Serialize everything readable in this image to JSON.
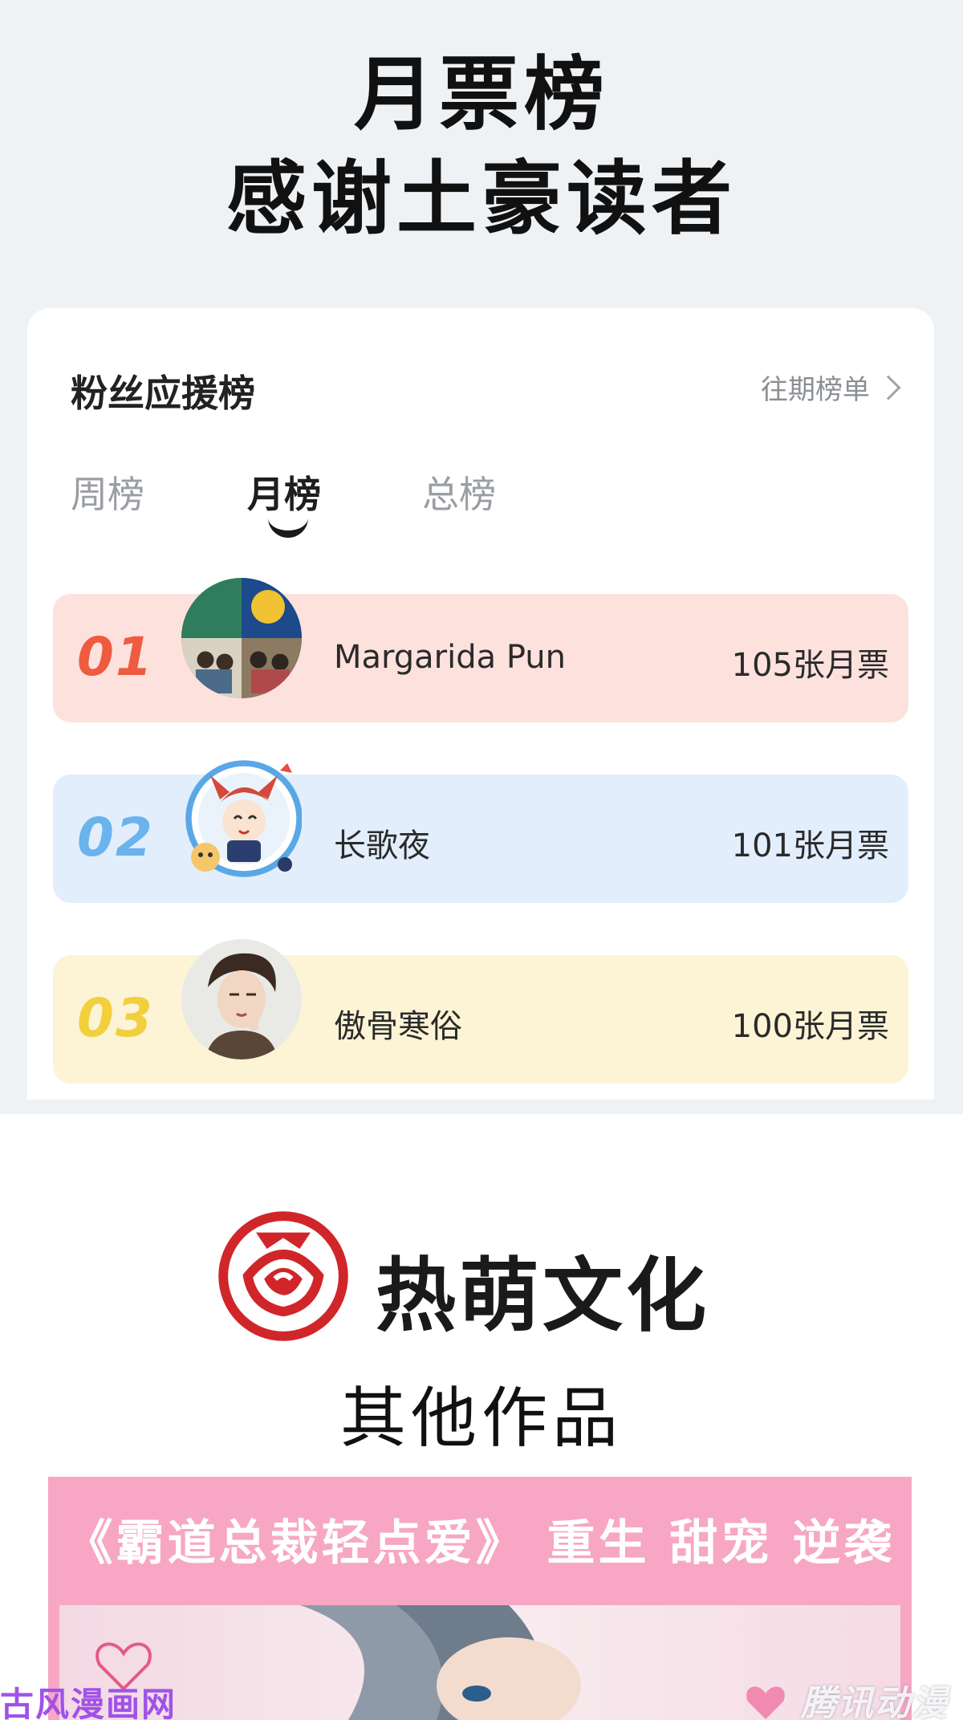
{
  "header": {
    "line1": "月票榜",
    "line2": "感谢土豪读者"
  },
  "fan_board": {
    "title": "粉丝应援榜",
    "history_link": "往期榜单",
    "tabs": [
      {
        "label": "周榜",
        "active": false
      },
      {
        "label": "月榜",
        "active": true
      },
      {
        "label": "总榜",
        "active": false
      }
    ],
    "ranks": [
      {
        "rank": "01",
        "name": "Margarida Pun",
        "tickets": "105张月票",
        "color": "#ef5b3f",
        "bg": "#fde1dd"
      },
      {
        "rank": "02",
        "name": "长歌夜",
        "tickets": "101张月票",
        "color": "#6ab3ec",
        "bg": "#e2eefc"
      },
      {
        "rank": "03",
        "name": "傲骨寒俗",
        "tickets": "100张月票",
        "color": "#f2cf3d",
        "bg": "#fdf4d6"
      }
    ]
  },
  "brand": {
    "name": "热萌文化",
    "logo_color": "#d0262a"
  },
  "other_works": "其他作品",
  "promo": {
    "text": "《霸道总裁轻点爱》 重生 甜宠 逆袭",
    "bg": "#f7a7c3"
  },
  "watermarks": {
    "left": "古风漫画网",
    "right": "腾讯动漫"
  }
}
